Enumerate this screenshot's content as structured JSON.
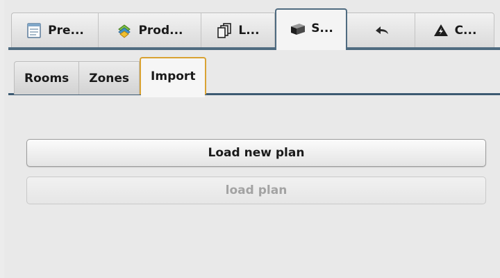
{
  "top_tabs": [
    {
      "label": "Pre...",
      "icon": "document-icon"
    },
    {
      "label": "Prod...",
      "icon": "products-icon"
    },
    {
      "label": "L...",
      "icon": "layers-icon"
    },
    {
      "label": "S...",
      "icon": "box-icon",
      "active": true
    },
    {
      "label": "",
      "icon": "undo-icon"
    },
    {
      "label": "C...",
      "icon": "warning-icon"
    }
  ],
  "sub_tabs": [
    {
      "label": "Rooms"
    },
    {
      "label": "Zones"
    },
    {
      "label": "Import",
      "active": true
    }
  ],
  "buttons": {
    "load_new_plan": "Load new plan",
    "load_plan": "load plan"
  },
  "colors": {
    "active_top_tab_border": "#4f6b80",
    "active_sub_tab_border": "#d9a233",
    "disabled_text": "#a3a3a3"
  }
}
